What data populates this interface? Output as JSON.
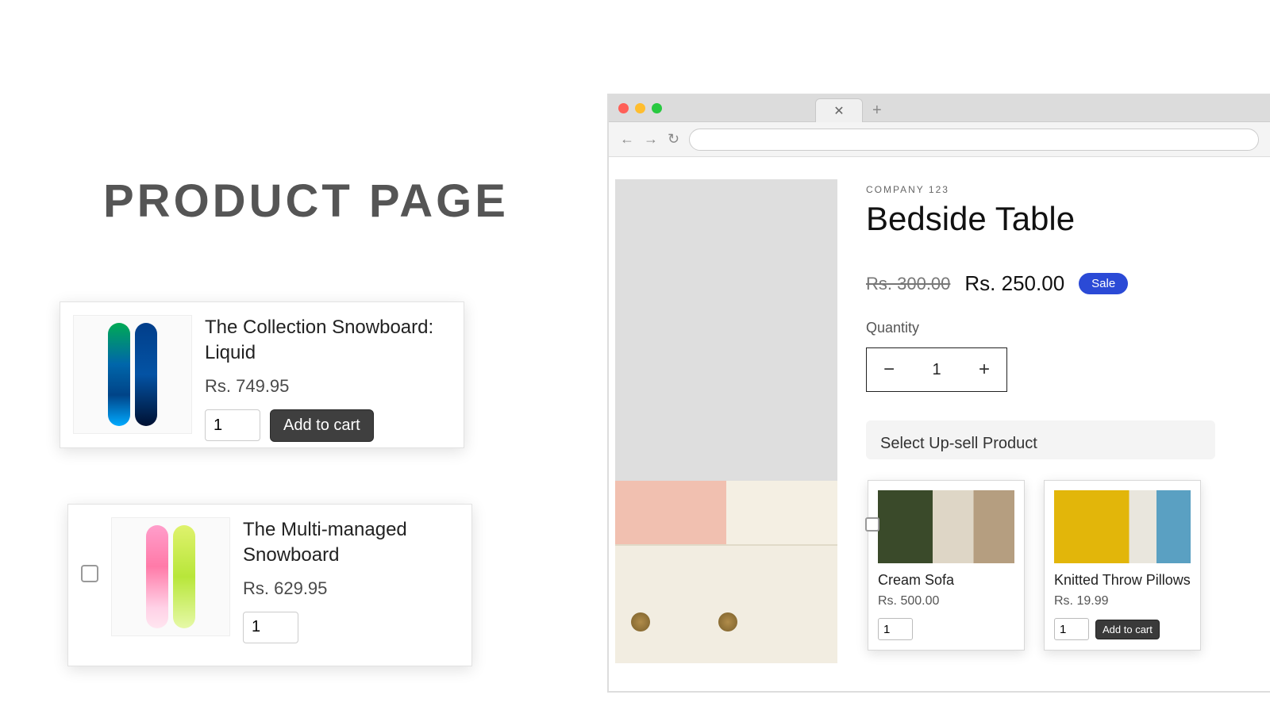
{
  "heading": "PRODUCT PAGE",
  "left_cards": [
    {
      "title": "The Collection Snowboard: Liquid",
      "price": "Rs. 749.95",
      "qty": "1",
      "add_label": "Add to cart",
      "has_checkbox": false
    },
    {
      "title": "The Multi-managed Snowboard",
      "price": "Rs. 629.95",
      "qty": "1",
      "add_label": "",
      "has_checkbox": true
    }
  ],
  "browser": {
    "tab_close": "✕",
    "tab_plus": "+",
    "nav_back": "←",
    "nav_fwd": "→",
    "nav_reload": "↻"
  },
  "product": {
    "company": "COMPANY 123",
    "title": "Bedside Table",
    "old_price": "Rs. 300.00",
    "new_price": "Rs. 250.00",
    "sale_label": "Sale",
    "qty_label": "Quantity",
    "qty_value": "1",
    "minus": "−",
    "plus": "+"
  },
  "upsell": {
    "heading": "Select Up-sell Product",
    "items": [
      {
        "title": "Cream Sofa",
        "price": "Rs. 500.00",
        "qty": "1",
        "add_label": ""
      },
      {
        "title": "Knitted Throw Pillows",
        "price": "Rs. 19.99",
        "qty": "1",
        "add_label": "Add to cart"
      }
    ]
  }
}
